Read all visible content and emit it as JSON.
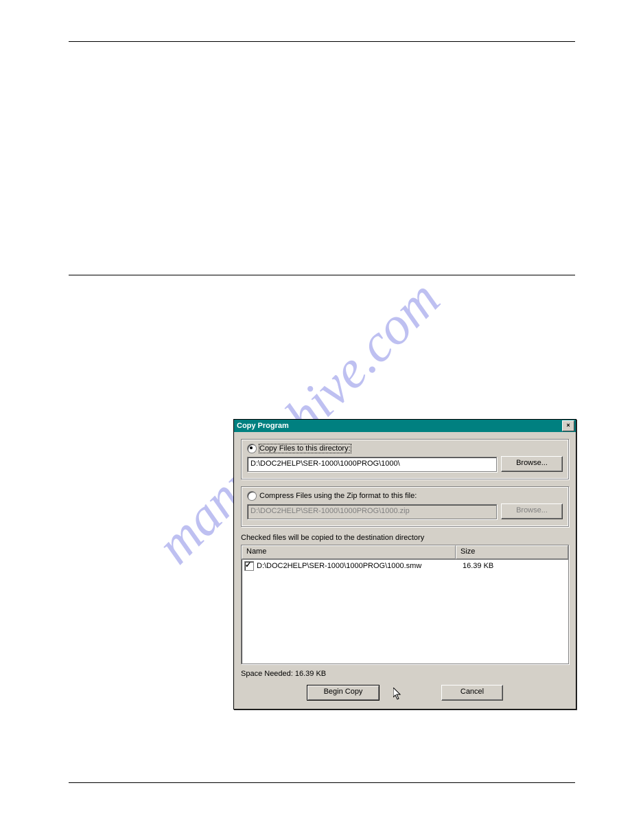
{
  "watermark_text": "manualshive.com",
  "dialog": {
    "title": "Copy Program",
    "copy_option": {
      "label": "Copy Files to this directory:",
      "path": "D:\\DOC2HELP\\SER-1000\\1000PROG\\1000\\",
      "browse": "Browse..."
    },
    "zip_option": {
      "label": "Compress Files using the Zip format to this file:",
      "path": "D:\\DOC2HELP\\SER-1000\\1000PROG\\1000.zip",
      "browse": "Browse..."
    },
    "list_label": "Checked files will be copied to the destination directory",
    "columns": {
      "name": "Name",
      "size": "Size"
    },
    "rows": [
      {
        "name": "D:\\DOC2HELP\\SER-1000\\1000PROG\\1000.smw",
        "size": "16.39 KB",
        "checked": true
      }
    ],
    "space_needed": "Space Needed: 16.39 KB",
    "buttons": {
      "begin": "Begin Copy",
      "cancel": "Cancel"
    }
  }
}
